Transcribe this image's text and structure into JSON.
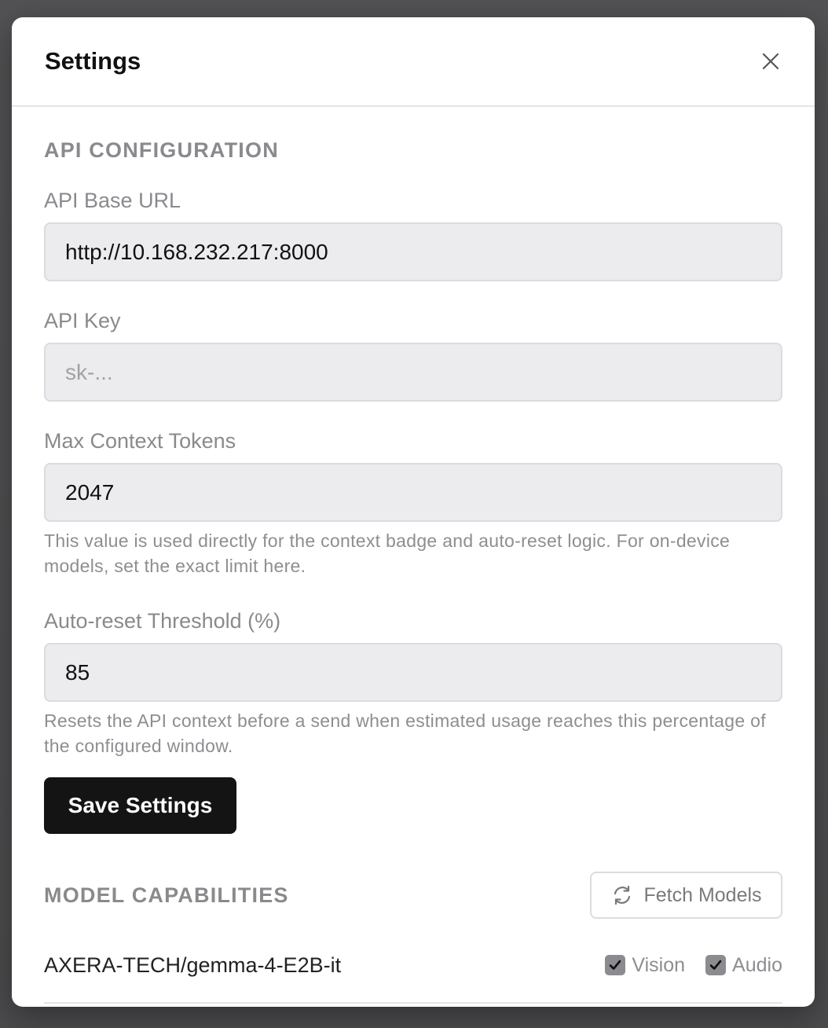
{
  "dialog": {
    "title": "Settings",
    "close_icon": "close-icon"
  },
  "api_config": {
    "section_title": "API CONFIGURATION",
    "base_url": {
      "label": "API Base URL",
      "value": "http://10.168.232.217:8000"
    },
    "api_key": {
      "label": "API Key",
      "value": "",
      "placeholder": "sk-..."
    },
    "max_context": {
      "label": "Max Context Tokens",
      "value": "2047",
      "help": "This value is used directly for the context badge and auto-reset logic. For on-device models, set the exact limit here."
    },
    "auto_reset": {
      "label": "Auto-reset Threshold (%)",
      "value": "85",
      "help": "Resets the API context before a send when estimated usage reaches this percentage of the configured window."
    },
    "save_label": "Save Settings"
  },
  "model_capabilities": {
    "section_title": "MODEL CAPABILITIES",
    "fetch_label": "Fetch Models",
    "fetch_icon": "refresh-icon",
    "models": [
      {
        "name": "AXERA-TECH/gemma-4-E2B-it",
        "vision_label": "Vision",
        "vision_checked": true,
        "audio_label": "Audio",
        "audio_checked": true
      }
    ]
  },
  "colors": {
    "primary_button": "#141414",
    "input_bg": "#ececef",
    "muted_text": "#8a8a8e",
    "checkbox_fill": "#8c8c90"
  }
}
